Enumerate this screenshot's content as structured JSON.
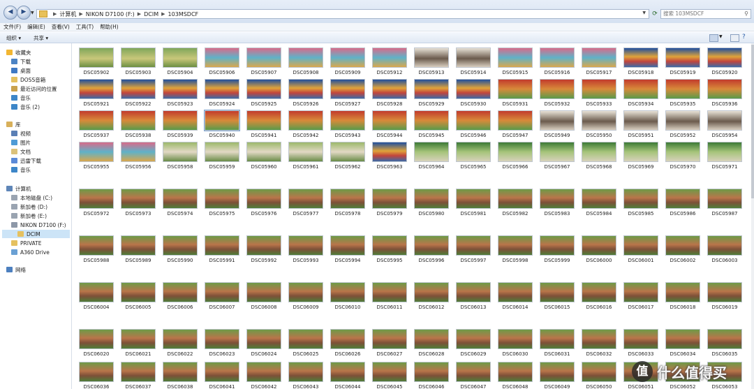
{
  "address_bar": {
    "crumbs": [
      "计算机",
      "NIKON D7100 (F:)",
      "DCIM",
      "103MSDCF"
    ],
    "search_placeholder": "搜索 103MSDCF"
  },
  "menu": [
    "文件(F)",
    "编辑(E)",
    "查看(V)",
    "工具(T)",
    "帮助(H)"
  ],
  "toolbar": {
    "organize": "组织 ▾",
    "share": "共享 ▾"
  },
  "sidebar": {
    "groups": [
      {
        "label": "收藏夹",
        "icon": "star-icon",
        "items": [
          {
            "label": "下载",
            "icon": "downloads-folder-icon"
          },
          {
            "label": "桌面",
            "icon": "desktop-icon"
          },
          {
            "label": "DOSS音箱",
            "icon": "folder-icon"
          },
          {
            "label": "最近访问的位置",
            "icon": "recent-places-icon"
          },
          {
            "label": "音乐",
            "icon": "music-icon"
          },
          {
            "label": "音乐 (2)",
            "icon": "music-icon"
          }
        ]
      },
      {
        "label": "库",
        "icon": "library-icon",
        "items": [
          {
            "label": "视频",
            "icon": "video-icon"
          },
          {
            "label": "图片",
            "icon": "pictures-icon"
          },
          {
            "label": "文档",
            "icon": "documents-icon"
          },
          {
            "label": "迅雷下载",
            "icon": "thunder-download-icon"
          },
          {
            "label": "音乐",
            "icon": "music-icon"
          }
        ]
      },
      {
        "label": "计算机",
        "icon": "computer-icon",
        "items": [
          {
            "label": "本地磁盘 (C:)",
            "icon": "drive-icon"
          },
          {
            "label": "新加卷 (D:)",
            "icon": "drive-icon"
          },
          {
            "label": "新加卷 (E:)",
            "icon": "drive-icon"
          },
          {
            "label": "NIKON D7100 (F:)",
            "icon": "removable-drive-icon"
          },
          {
            "label": "DCIM",
            "icon": "folder-icon",
            "selected": true
          },
          {
            "label": "PRIVATE",
            "icon": "folder-icon"
          },
          {
            "label": "A360 Drive",
            "icon": "cloud-drive-icon"
          }
        ]
      },
      {
        "label": "网络",
        "icon": "network-icon",
        "items": []
      }
    ]
  },
  "files": [
    "DSC05902",
    "DSC05903",
    "DSC05904",
    "DSC05906",
    "DSC05907",
    "DSC05908",
    "DSC05909",
    "DSC05912",
    "DSC05913",
    "DSC05914",
    "DSC05915",
    "DSC05916",
    "DSC05917",
    "DSC05918",
    "DSC05919",
    "DSC05920",
    "DSC05921",
    "DSC05922",
    "DSC05923",
    "DSC05924",
    "DSC05925",
    "DSC05926",
    "DSC05927",
    "DSC05928",
    "DSC05929",
    "DSC05930",
    "DSC05931",
    "DSC05932",
    "DSC05933",
    "DSC05934",
    "DSC05935",
    "DSC05936",
    "DSC05937",
    "DSC05938",
    "DSC05939",
    "DSC05940",
    "DSC05941",
    "DSC05942",
    "DSC05943",
    "DSC05944",
    "DSC05945",
    "DSC05946",
    "DSC05947",
    "DSC05949",
    "DSC05950",
    "DSC05951",
    "DSC05952",
    "DSC05954",
    "DSC05955",
    "DSC05956",
    "DSC05958",
    "DSC05959",
    "DSC05960",
    "DSC05961",
    "DSC05962",
    "DSC05963",
    "DSC05964",
    "DSC05965",
    "DSC05966",
    "DSC05967",
    "DSC05968",
    "DSC05969",
    "DSC05970",
    "DSC05971",
    "DSC05972",
    "DSC05973",
    "DSC05974",
    "DSC05975",
    "DSC05976",
    "DSC05977",
    "DSC05978",
    "DSC05979",
    "DSC05980",
    "DSC05981",
    "DSC05982",
    "DSC05983",
    "DSC05984",
    "DSC05985",
    "DSC05986",
    "DSC05987",
    "DSC05988",
    "DSC05989",
    "DSC05990",
    "DSC05991",
    "DSC05992",
    "DSC05993",
    "DSC05994",
    "DSC05995",
    "DSC05996",
    "DSC05997",
    "DSC05998",
    "DSC05999",
    "DSC06000",
    "DSC06001",
    "DSC06002",
    "DSC06003",
    "DSC06004",
    "DSC06005",
    "DSC06006",
    "DSC06007",
    "DSC06008",
    "DSC06009",
    "DSC06010",
    "DSC06011",
    "DSC06012",
    "DSC06013",
    "DSC06014",
    "DSC06015",
    "DSC06016",
    "DSC06017",
    "DSC06018",
    "DSC06019",
    "DSC06020",
    "DSC06021",
    "DSC06022",
    "DSC06023",
    "DSC06024",
    "DSC06025",
    "DSC06026",
    "DSC06027",
    "DSC06028",
    "DSC06029",
    "DSC06030",
    "DSC06031",
    "DSC06032",
    "DSC06033",
    "DSC06034",
    "DSC06035",
    "DSC06036",
    "DSC06037",
    "DSC06038",
    "DSC06041",
    "DSC06042",
    "DSC06043",
    "DSC06044",
    "DSC06045",
    "DSC06046",
    "DSC06047",
    "DSC06048",
    "DSC06049",
    "DSC06050",
    "DSC06051",
    "DSC06052",
    "DSC06053"
  ],
  "selected_file": "DSC05940",
  "watermark": {
    "badge": "值",
    "text": "什么值得买"
  }
}
